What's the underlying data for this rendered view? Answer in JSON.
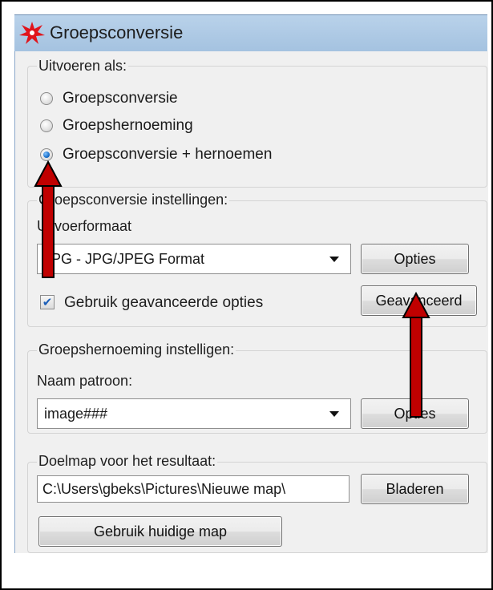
{
  "window": {
    "title": "Groepsconversie"
  },
  "run_as": {
    "label": "Uitvoeren als:",
    "options": [
      {
        "label": "Groepsconversie",
        "checked": false
      },
      {
        "label": "Groepshernoeming",
        "checked": false
      },
      {
        "label": "Groepsconversie + hernoemen",
        "checked": true
      }
    ]
  },
  "conversion_settings": {
    "label": "Groepsconversie instellingen:",
    "format_label": "Uitvoerformaat",
    "format_value": "JPG - JPG/JPEG Format",
    "options_button": "Opties",
    "advanced_checkbox_label": "Gebruik geavanceerde opties",
    "advanced_checked": true,
    "advanced_button": "Geavanceerd"
  },
  "rename_settings": {
    "label": "Groepshernoeming instelligen:",
    "pattern_label": "Naam patroon:",
    "pattern_value": "image###",
    "options_button": "Opties"
  },
  "destination": {
    "label": "Doelmap voor het resultaat:",
    "path": "C:\\Users\\gbeks\\Pictures\\Nieuwe map\\",
    "browse_button": "Bladeren",
    "current_folder_button": "Gebruik huidige map"
  },
  "colors": {
    "arrow": "#c00000",
    "titlebar": "#b9d2ea",
    "radio_selected": "#1b6fc9"
  }
}
